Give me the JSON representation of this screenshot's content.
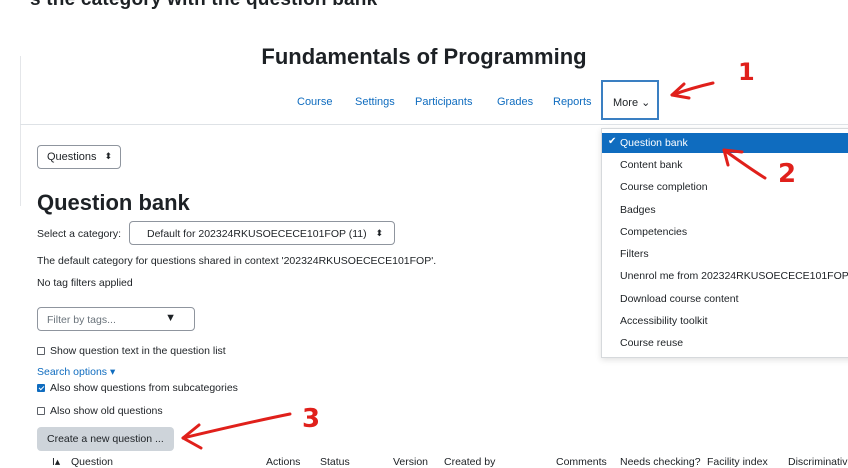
{
  "top_partial_text": "s the category with the question bank",
  "course": {
    "title": "Fundamentals of Programming",
    "nav": [
      {
        "label": "Course"
      },
      {
        "label": "Settings"
      },
      {
        "label": "Participants"
      },
      {
        "label": "Grades"
      },
      {
        "label": "Reports"
      }
    ],
    "more_label": "More ⌄"
  },
  "question_bank": {
    "selector_value": "Questions",
    "heading": "Question bank",
    "category_label": "Select a category:",
    "category_value": "Default for 202324RKUSOECECE101FOP (11)",
    "default_text": "The default category for questions shared in context '202324RKUSOECECE101FOP'.",
    "no_tag_text": "No tag filters applied",
    "filter_placeholder": "Filter by tags...",
    "show_text_label": "Show question text in the question list",
    "search_options_label": "Search options ▾",
    "subcategories_label": "Also show questions from subcategories",
    "old_questions_label": "Also show old questions",
    "create_button": "Create a new question ..."
  },
  "table_headers": [
    "Question",
    "Actions",
    "Status",
    "Version",
    "Created by",
    "Comments",
    "Needs checking?",
    "Facility index",
    "Discriminative"
  ],
  "more_menu": {
    "items": [
      {
        "label": "Question bank",
        "active": true
      },
      {
        "label": "Content bank"
      },
      {
        "label": "Course completion"
      },
      {
        "label": "Badges"
      },
      {
        "label": "Competencies"
      },
      {
        "label": "Filters"
      },
      {
        "label": "Unenrol me from 202324RKUSOECECE101FOP"
      },
      {
        "label": "Download course content"
      },
      {
        "label": "Accessibility toolkit"
      },
      {
        "label": "Course reuse"
      }
    ]
  },
  "annotations": {
    "n1": "1",
    "n2": "2",
    "n3": "3"
  },
  "colors": {
    "link": "#0f6cbf",
    "active_bg": "#0f6cbf",
    "annotation": "#e0201b"
  }
}
